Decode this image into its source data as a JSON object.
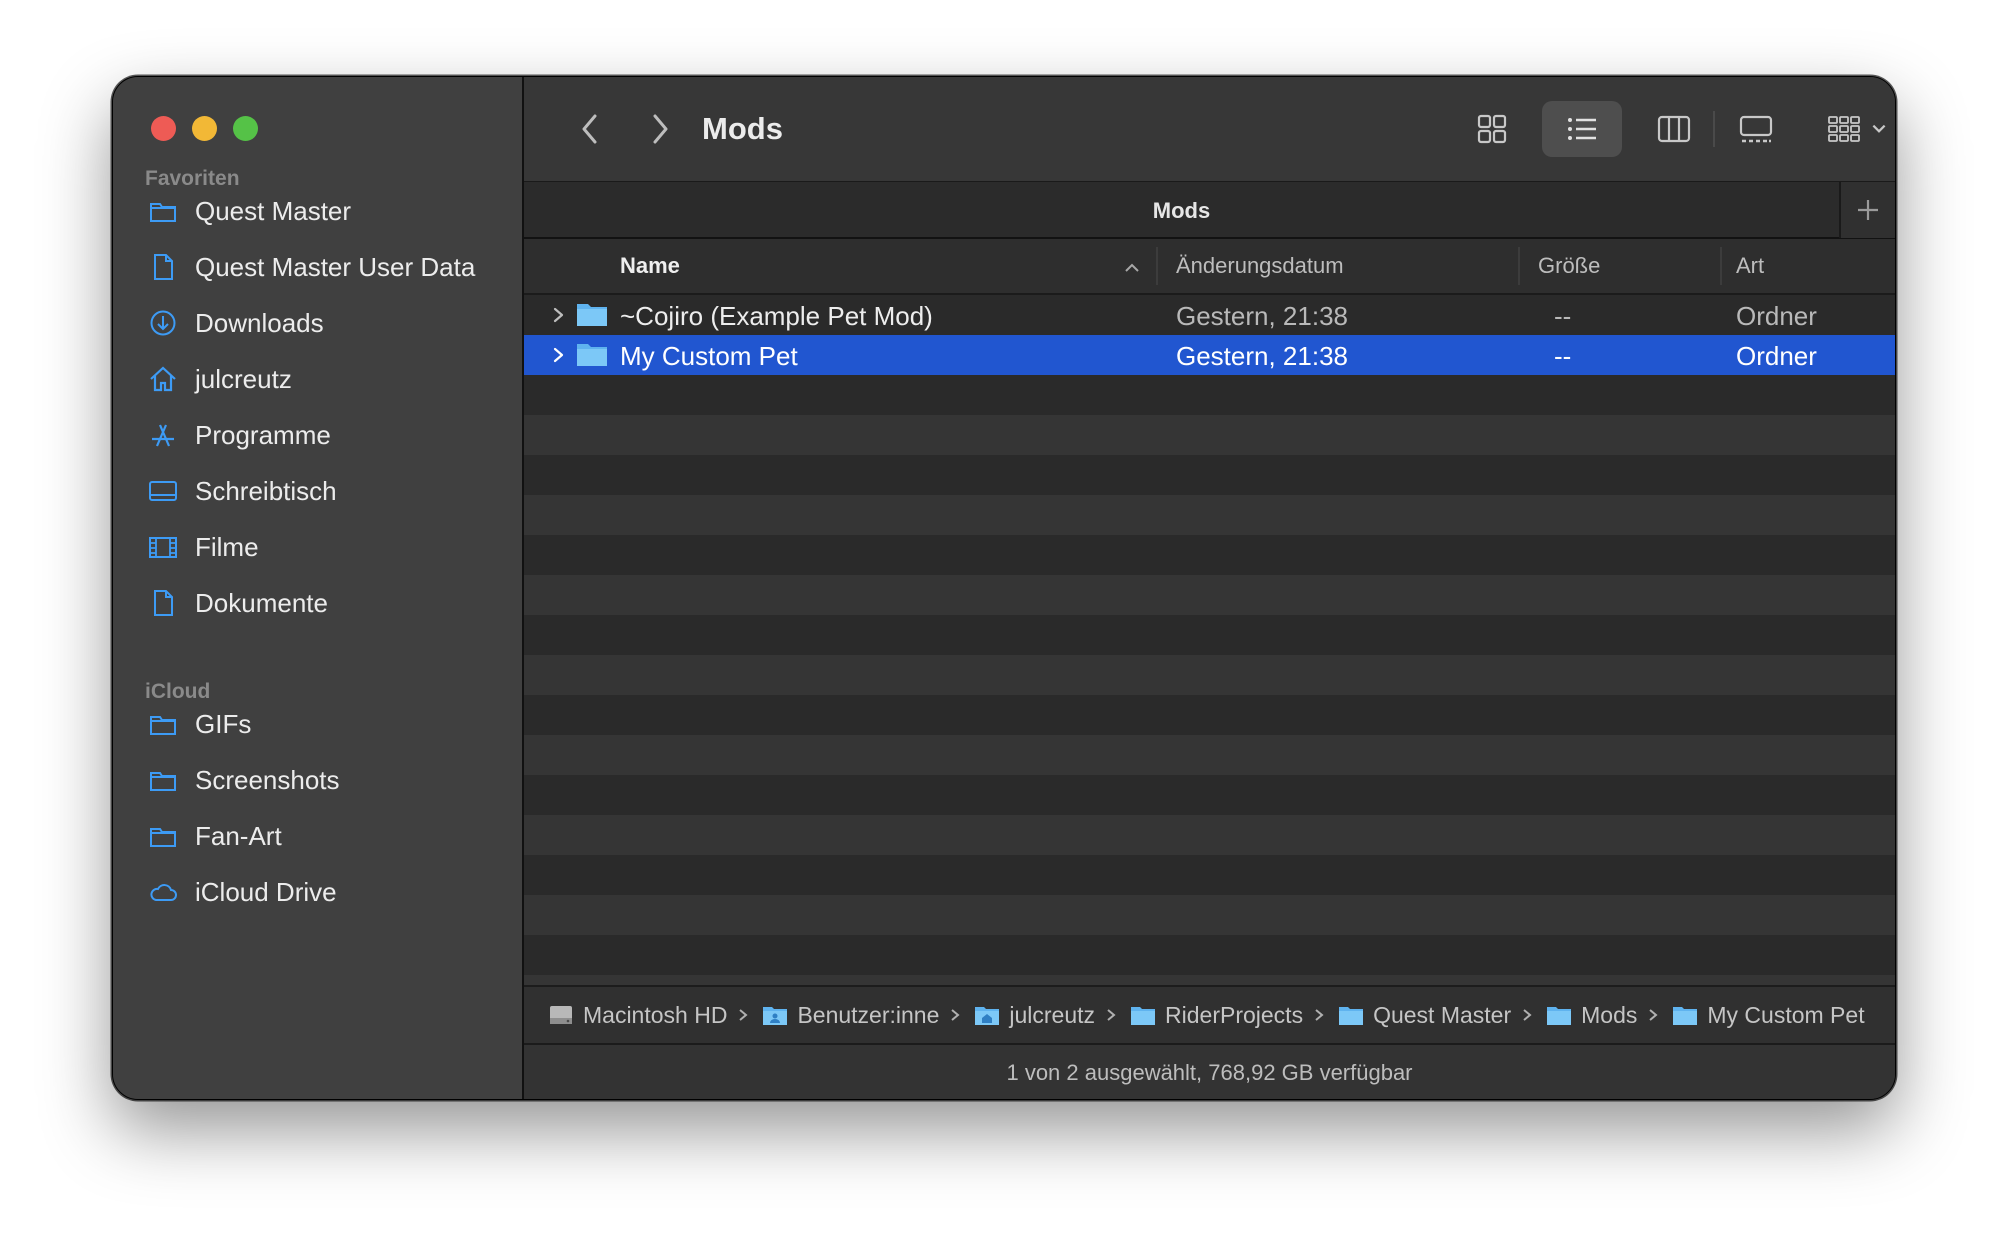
{
  "sidebar": {
    "favorites_header": "Favoriten",
    "favorites": [
      {
        "label": "Quest Master",
        "icon": "folder-icon"
      },
      {
        "label": "Quest Master User Data",
        "icon": "document-icon"
      },
      {
        "label": "Downloads",
        "icon": "downloads-icon"
      },
      {
        "label": "julcreutz",
        "icon": "home-icon"
      },
      {
        "label": "Programme",
        "icon": "applications-icon"
      },
      {
        "label": "Schreibtisch",
        "icon": "desktop-icon"
      },
      {
        "label": "Filme",
        "icon": "film-icon"
      },
      {
        "label": "Dokumente",
        "icon": "document-icon"
      }
    ],
    "icloud_header": "iCloud",
    "icloud": [
      {
        "label": "GIFs",
        "icon": "folder-icon"
      },
      {
        "label": "Screenshots",
        "icon": "folder-icon"
      },
      {
        "label": "Fan-Art",
        "icon": "folder-icon"
      },
      {
        "label": "iCloud Drive",
        "icon": "cloud-icon"
      }
    ]
  },
  "toolbar": {
    "title": "Mods",
    "view_mode": "list",
    "accent_color": "#2156d0"
  },
  "tab": {
    "title": "Mods"
  },
  "columns": {
    "name": "Name",
    "date": "Änderungsdatum",
    "size": "Größe",
    "kind": "Art"
  },
  "files": [
    {
      "name": "~Cojiro (Example Pet Mod)",
      "date": "Gestern, 21:38",
      "size": "--",
      "kind": "Ordner",
      "selected": false
    },
    {
      "name": "My Custom Pet",
      "date": "Gestern, 21:38",
      "size": "--",
      "kind": "Ordner",
      "selected": true
    }
  ],
  "pathbar": [
    {
      "label": "Macintosh HD",
      "icon": "hard-drive-icon"
    },
    {
      "label": "Benutzer:inne",
      "icon": "users-folder-icon"
    },
    {
      "label": "julcreutz",
      "icon": "home-folder-icon"
    },
    {
      "label": "RiderProjects",
      "icon": "folder-icon"
    },
    {
      "label": "Quest Master",
      "icon": "folder-icon"
    },
    {
      "label": "Mods",
      "icon": "folder-icon"
    },
    {
      "label": "My Custom Pet",
      "icon": "folder-icon"
    }
  ],
  "status": "1 von 2 ausgewählt, 768,92 GB verfügbar"
}
